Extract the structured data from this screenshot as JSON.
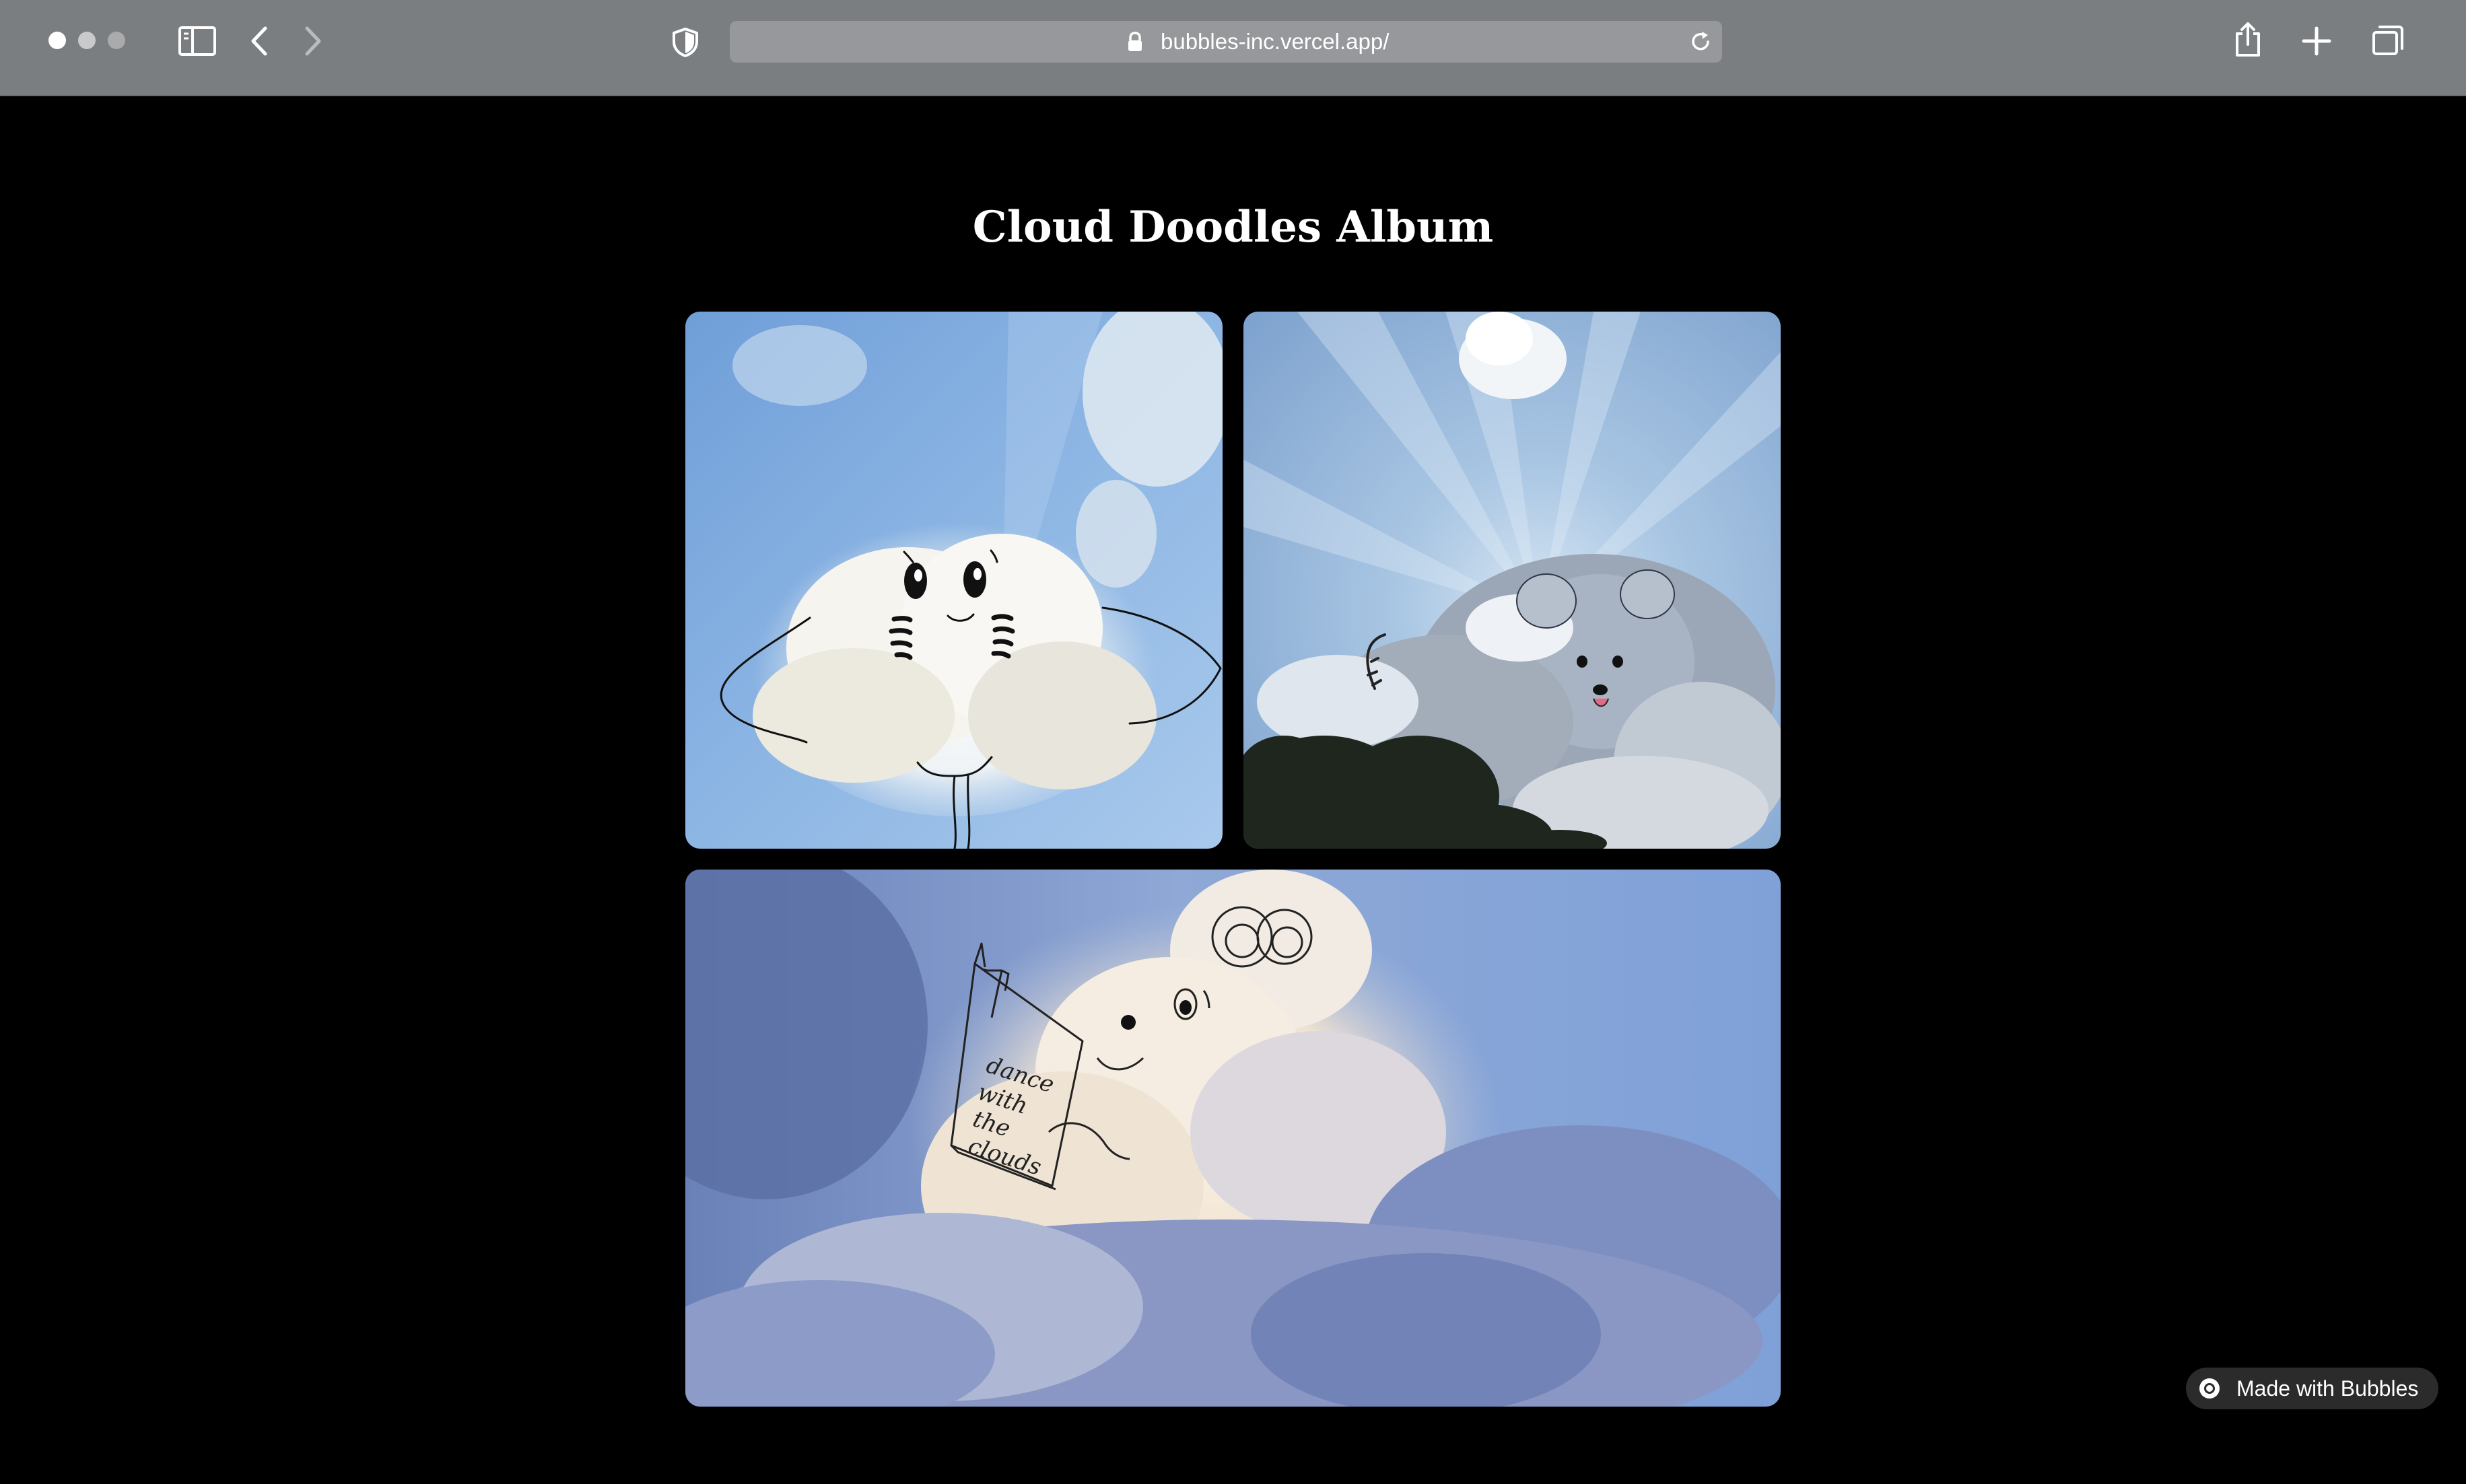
{
  "browser": {
    "url": "bubbles-inc.vercel.app/",
    "icons": [
      "sidebar-icon",
      "back-icon",
      "forward-icon",
      "shield-icon",
      "lock-icon",
      "reload-icon",
      "share-icon",
      "new-tab-icon",
      "tabs-overview-icon"
    ]
  },
  "page": {
    "title": "Cloud Doodles Album"
  },
  "gallery": {
    "photos": [
      {
        "subject": "stingray-cloud-doodle"
      },
      {
        "subject": "raccoon-bear-cloud-doodle"
      },
      {
        "subject": "mouse-reading-book-cloud-doodle",
        "book_text": [
          "dance",
          "with",
          "the",
          "clouds"
        ]
      }
    ]
  },
  "badge": {
    "label": "Made with Bubbles"
  },
  "colors": {
    "toolbar": "#7b7e81",
    "url_bar": "#96989b",
    "page_background": "#000000",
    "badge_background": "#2b2b2b"
  }
}
